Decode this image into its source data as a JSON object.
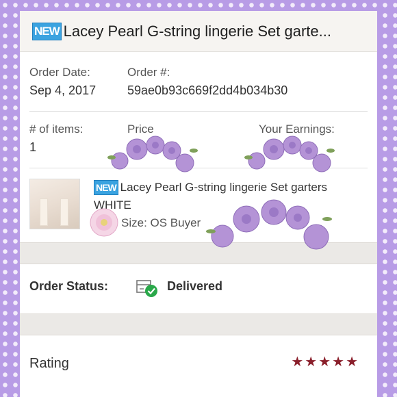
{
  "badge": "NEW",
  "title": "Lacey Pearl G-string lingerie Set garte...",
  "order_date_label": "Order Date:",
  "order_date": "Sep 4, 2017",
  "order_num_label": "Order #:",
  "order_num": "59ae0b93c669f2dd4b034b30",
  "items_label": "# of items:",
  "items_value": "1",
  "price_label": "Price",
  "earnings_label": "Your Earnings:",
  "item_badge": "NEW",
  "item_title_line1": "Lacey Pearl G-string lingerie Set garters",
  "item_title_line2": "WHITE",
  "item_size": "Size: OS  Buyer",
  "status_label": "Order Status:",
  "status_value": "Delivered",
  "rating_label": "Rating",
  "rating_stars": "★★★★★",
  "colors": {
    "frame": "#b89ce6",
    "star": "#8a1f2b",
    "badge": "#3ba3e0",
    "check": "#2aa84a"
  }
}
